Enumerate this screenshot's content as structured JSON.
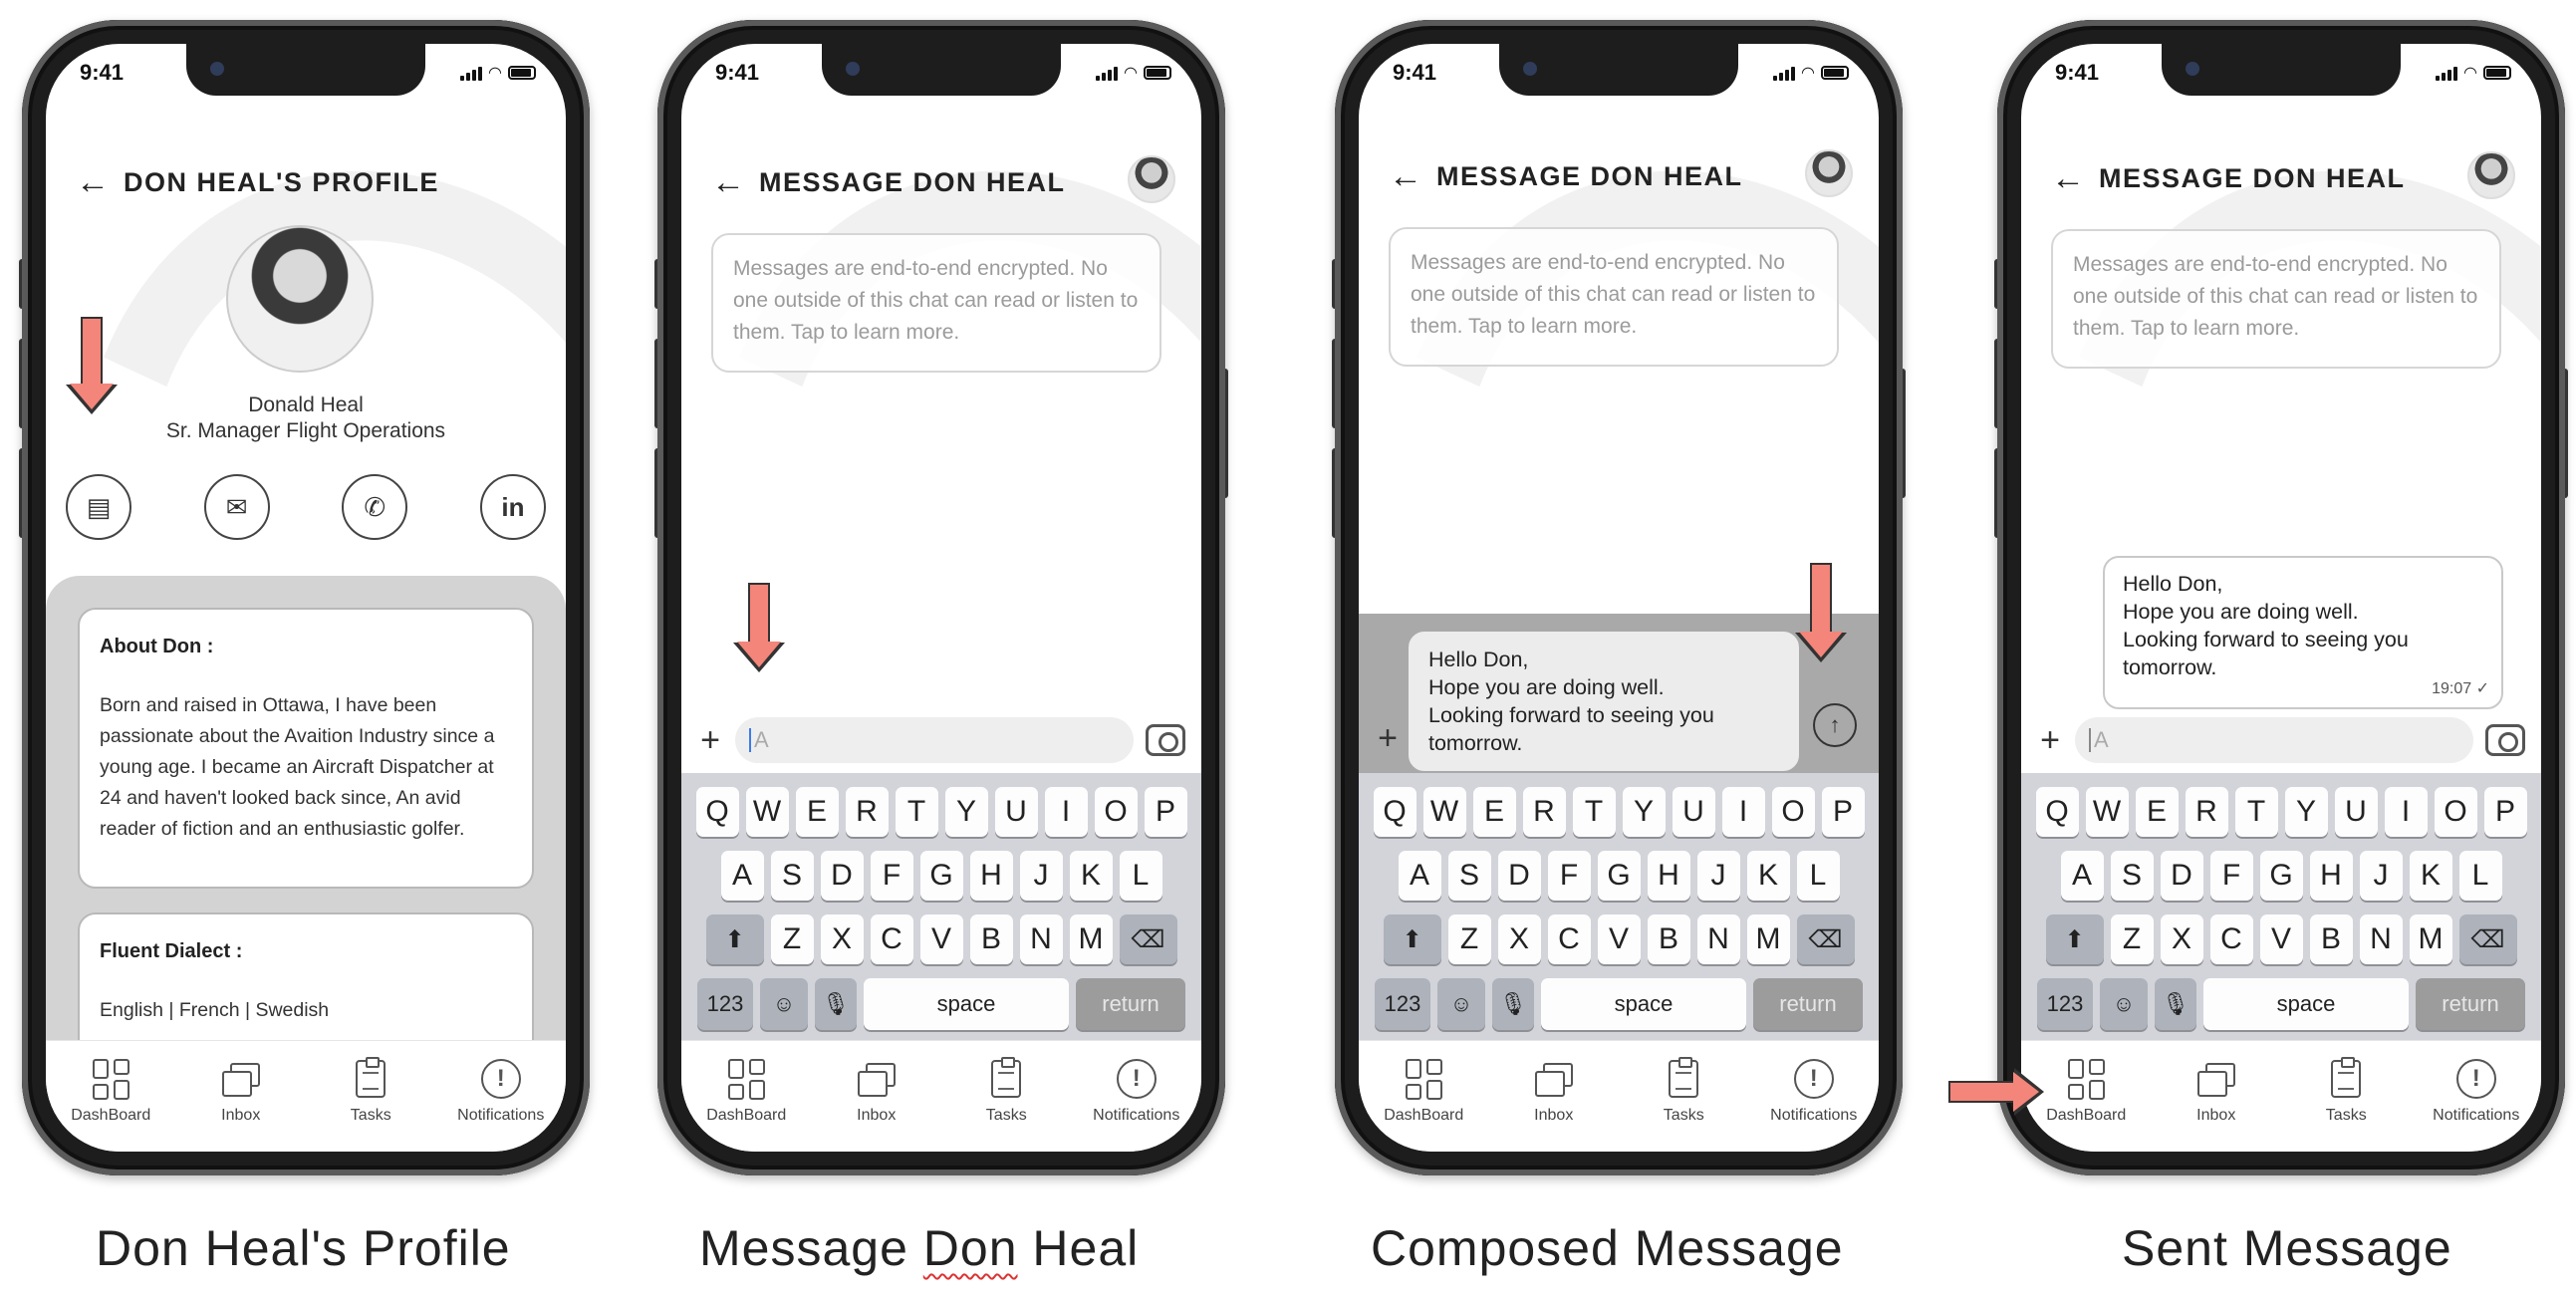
{
  "status": {
    "time": "9:41"
  },
  "tabs": [
    "DashBoard",
    "Inbox",
    "Tasks",
    "Notifications"
  ],
  "keyboard": {
    "row1": [
      "Q",
      "W",
      "E",
      "R",
      "T",
      "Y",
      "U",
      "I",
      "O",
      "P"
    ],
    "row2": [
      "A",
      "S",
      "D",
      "F",
      "G",
      "H",
      "J",
      "K",
      "L"
    ],
    "row3": [
      "Z",
      "X",
      "C",
      "V",
      "B",
      "N",
      "M"
    ],
    "num": "123",
    "space": "space",
    "return": "return"
  },
  "profile": {
    "title": "DON HEAL'S PROFILE",
    "name": "Donald Heal",
    "role": "Sr. Manager Flight Operations",
    "about_heading": "About Don :",
    "about_text": "Born and raised in Ottawa, I have been passionate about the Avaition Industry since a young age. I became an Aircraft Dispatcher at 24 and haven't looked back since, An avid reader of fiction and an enthusiastic golfer.",
    "dialect_heading": "Fluent Dialect :",
    "dialect_text": "English | French | Swedish",
    "actions": [
      "message-icon",
      "email-icon",
      "phone-icon",
      "linkedin-icon"
    ]
  },
  "message": {
    "title": "MESSAGE DON HEAL",
    "encryption_notice": "Messages are end-to-end encrypted. No one outside of this chat can read or listen to them. Tap to learn more.",
    "input_placeholder": "A"
  },
  "composed": {
    "line1": "Hello Don,",
    "line2": "Hope you are doing well.",
    "line3": "Looking forward to seeing you",
    "line4": "tomorrow."
  },
  "sent": {
    "timestamp": "19:07",
    "check": "✓"
  },
  "captions": {
    "profile": "Don Heal's Profile",
    "message_prefix": "Message ",
    "message_sq": "Don",
    "message_suffix": " Heal",
    "composed": "Composed Message",
    "sent": "Sent Message"
  },
  "colors": {
    "arrow": "#f4857a",
    "panel": "#d3d3d3",
    "keyboard": "#d2d4da"
  }
}
